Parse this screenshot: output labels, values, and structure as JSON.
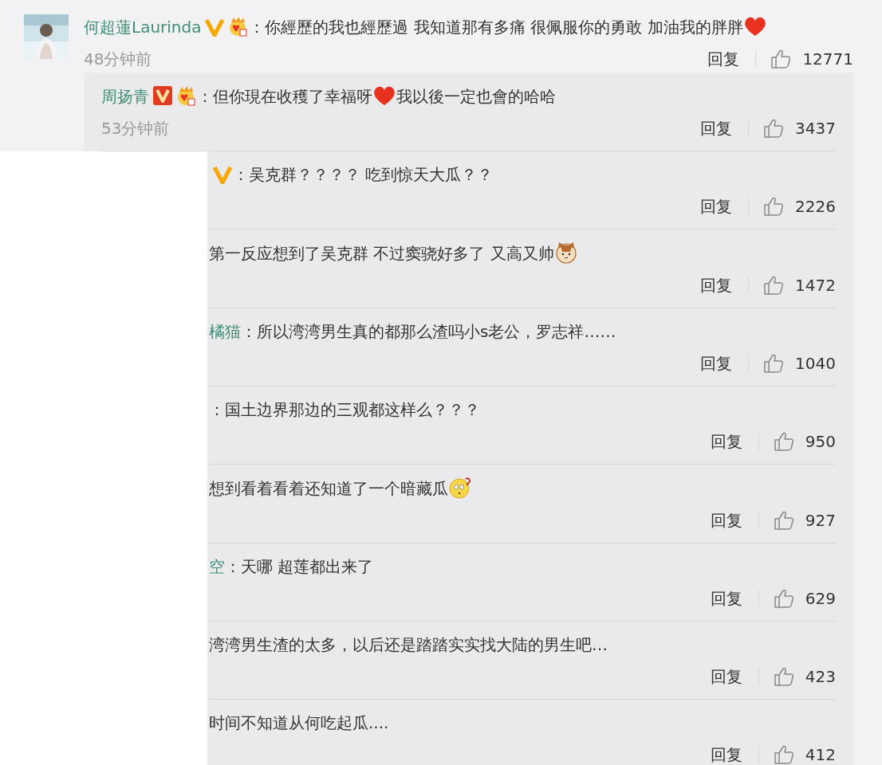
{
  "comment": {
    "author": "何超蓮Laurinda",
    "badges": [
      {
        "kind": "verified-yellow"
      },
      {
        "kind": "fan-crown"
      }
    ],
    "segments": [
      {
        "kind": "text",
        "text": "：你經歷的我也經歷過 我知道那有多痛 很佩服你的勇敢 加油我的胖胖"
      },
      {
        "kind": "heart"
      }
    ],
    "time": "48分钟前",
    "reply_label": "回复",
    "likes": "12771"
  },
  "replies": [
    {
      "author": "周扬青",
      "badges": [
        {
          "kind": "verified-red"
        },
        {
          "kind": "fan-crown"
        }
      ],
      "segments": [
        {
          "kind": "text",
          "text": "：但你現在收穫了幸福呀"
        },
        {
          "kind": "heart"
        },
        {
          "kind": "text",
          "text": "我以後一定也會的哈哈"
        }
      ],
      "time": "53分钟前",
      "reply_label": "回复",
      "likes": "3437"
    },
    {
      "badges": [
        {
          "kind": "verified-yellow"
        }
      ],
      "segments": [
        {
          "kind": "text",
          "text": "：吴克群？？？？ 吃到惊天大瓜？？"
        }
      ],
      "reply_label": "回复",
      "likes": "2226"
    },
    {
      "segments": [
        {
          "kind": "text",
          "text": "第一反应想到了吴克群 不过窦骁好多了 又高又帅"
        },
        {
          "kind": "cat"
        }
      ],
      "reply_label": "回复",
      "likes": "1472"
    },
    {
      "author": "橘猫",
      "segments": [
        {
          "kind": "text",
          "text": "：所以湾湾男生真的都那么渣吗小s老公，罗志祥……"
        }
      ],
      "reply_label": "回复",
      "likes": "1040"
    },
    {
      "segments": [
        {
          "kind": "text",
          "text": "：国土边界那边的三观都这样么？？？"
        }
      ],
      "reply_label": "回复",
      "likes": "950"
    },
    {
      "segments": [
        {
          "kind": "text",
          "text": "想到看着看着还知道了一个暗藏瓜"
        },
        {
          "kind": "puzzled"
        }
      ],
      "reply_label": "回复",
      "likes": "927"
    },
    {
      "author": "空",
      "segments": [
        {
          "kind": "text",
          "text": "：天哪 超莲都出来了"
        }
      ],
      "reply_label": "回复",
      "likes": "629"
    },
    {
      "segments": [
        {
          "kind": "text",
          "text": "湾湾男生渣的太多，以后还是踏踏实实找大陆的男生吧…"
        }
      ],
      "reply_label": "回复",
      "likes": "423"
    },
    {
      "segments": [
        {
          "kind": "text",
          "text": "时间不知道从何吃起瓜...."
        }
      ],
      "reply_label": "回复",
      "likes": "412"
    }
  ]
}
